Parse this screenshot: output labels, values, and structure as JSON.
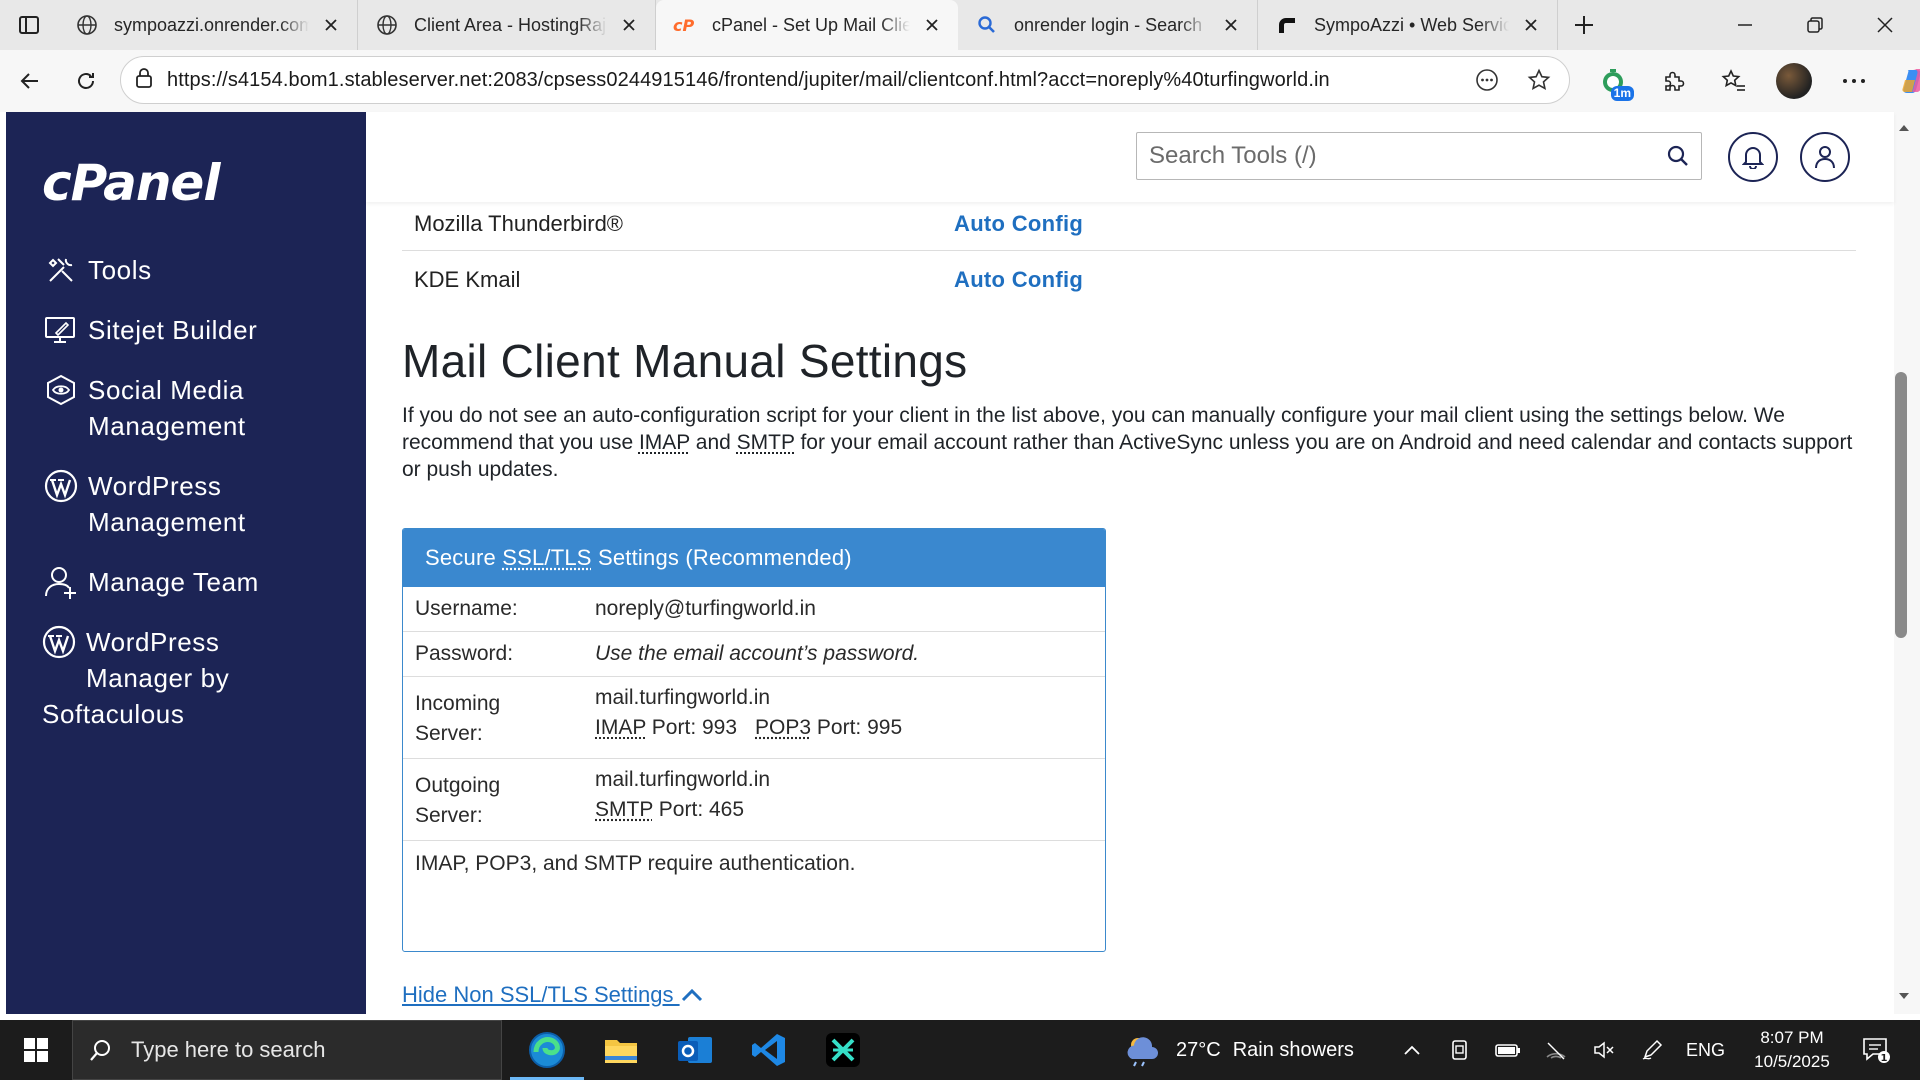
{
  "browser": {
    "tabs": [
      {
        "title": "sympoazzi.onrender.com/a",
        "icon": "globe-icon",
        "active": false
      },
      {
        "title": "Client Area - HostingRaja",
        "icon": "globe-icon",
        "active": false
      },
      {
        "title": "cPanel - Set Up Mail Client",
        "icon": "cpanel-icon",
        "active": true
      },
      {
        "title": "onrender login - Search",
        "icon": "search-icon",
        "active": false
      },
      {
        "title": "SympoAzzi • Web Service",
        "icon": "render-icon",
        "active": false
      }
    ],
    "url": "https://s4154.bom1.stableserver.net:2083/cpsess0244915146/frontend/jupiter/mail/clientconf.html?acct=noreply%40turfingworld.in",
    "extension_badge": "1m"
  },
  "sidebar": {
    "logo": "cPanel",
    "items": [
      {
        "label": "Tools",
        "icon": "tools-icon"
      },
      {
        "label": "Sitejet Builder",
        "icon": "sitejet-icon"
      },
      {
        "label": "Social Media Management",
        "icon": "social-media-icon"
      },
      {
        "label": "WordPress Management",
        "icon": "wordpress-icon"
      },
      {
        "label": "Manage Team",
        "icon": "team-icon"
      },
      {
        "label_line1": "WordPress",
        "label_line2": "Manager by",
        "label_line3": "Softaculous",
        "icon": "wordpress-icon"
      }
    ]
  },
  "header": {
    "search_placeholder": "Search Tools (/)"
  },
  "content": {
    "clients": [
      {
        "name": "Mozilla Thunderbird®",
        "action": "Auto Config"
      },
      {
        "name": "KDE Kmail",
        "action": "Auto Config"
      }
    ],
    "manual_title": "Mail Client Manual Settings",
    "manual_desc_1": "If you do not see an auto-configuration script for your client in the list above, you can manually configure your mail client using the settings below. We recommend that you use ",
    "imap": "IMAP",
    "and": " and ",
    "smtp": "SMTP",
    "manual_desc_2": " for your email account rather than ActiveSync unless you are on Android and need calendar and contacts support or push updates.",
    "ssl_panel": {
      "title_prefix": "Secure ",
      "title_abbr": "SSL/TLS",
      "title_suffix": " Settings (Recommended)",
      "username_label": "Username:",
      "username_value": "noreply@turfingworld.in",
      "password_label": "Password:",
      "password_value": "Use the email account’s password.",
      "incoming_label_1": "Incoming",
      "incoming_label_2": "Server:",
      "incoming_host": "mail.turfingworld.in",
      "imap_label": "IMAP",
      "imap_port": " Port: 993",
      "pop3_label": "POP3",
      "pop3_port": " Port: 995",
      "outgoing_label_1": "Outgoing",
      "outgoing_label_2": "Server:",
      "outgoing_host": "mail.turfingworld.in",
      "smtp_label": "SMTP",
      "smtp_port": " Port: 465",
      "auth_note": "IMAP, POP3, and SMTP require authentication."
    },
    "hide_link": "Hide Non SSL/TLS Settings "
  },
  "taskbar": {
    "search_placeholder": "Type here to search",
    "weather_temp": "27°C",
    "weather_desc": "Rain showers",
    "language": "ENG",
    "time": "8:07 PM",
    "date": "10/5/2025",
    "notification_count": "1"
  },
  "colors": {
    "sidebar_bg": "#1c2455",
    "link_blue": "#1f6fc0",
    "panel_header": "#3a88cf",
    "taskbar_bg": "#1c1c1c"
  }
}
